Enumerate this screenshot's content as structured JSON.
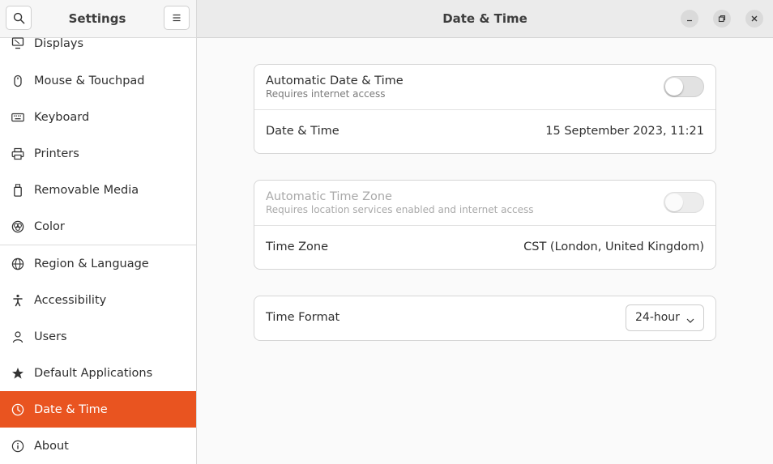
{
  "sidebar": {
    "title": "Settings",
    "search_icon": "search-icon",
    "menu_icon": "hamburger-menu-icon",
    "items": [
      {
        "label": "Displays",
        "icon": "display-icon"
      },
      {
        "label": "Mouse & Touchpad",
        "icon": "mouse-icon"
      },
      {
        "label": "Keyboard",
        "icon": "keyboard-icon"
      },
      {
        "label": "Printers",
        "icon": "printer-icon"
      },
      {
        "label": "Removable Media",
        "icon": "usb-drive-icon"
      },
      {
        "label": "Color",
        "icon": "color-palette-icon"
      },
      {
        "label": "Region & Language",
        "icon": "globe-icon"
      },
      {
        "label": "Accessibility",
        "icon": "accessibility-icon"
      },
      {
        "label": "Users",
        "icon": "user-icon"
      },
      {
        "label": "Default Applications",
        "icon": "star-icon"
      },
      {
        "label": "Date & Time",
        "icon": "clock-icon",
        "active": true
      },
      {
        "label": "About",
        "icon": "info-icon"
      }
    ]
  },
  "header": {
    "title": "Date & Time",
    "minimize_icon": "minimize-icon",
    "restore_icon": "restore-icon",
    "close_icon": "close-icon"
  },
  "date_time_card": {
    "automatic_date_time": {
      "title": "Automatic Date & Time",
      "subtitle": "Requires internet access",
      "enabled": false
    },
    "date_time": {
      "title": "Date & Time",
      "value": "15 September 2023, 11:21"
    }
  },
  "time_zone_card": {
    "automatic_time_zone": {
      "title": "Automatic Time Zone",
      "subtitle": "Requires location services enabled and internet access",
      "enabled": false,
      "sensitive": false
    },
    "time_zone": {
      "title": "Time Zone",
      "value": "CST (London, United Kingdom)"
    }
  },
  "time_format_card": {
    "title": "Time Format",
    "selected": "24-hour"
  },
  "colors": {
    "accent": "#e95420",
    "sidebar_bg": "#ffffff",
    "content_bg": "#fafafa"
  }
}
